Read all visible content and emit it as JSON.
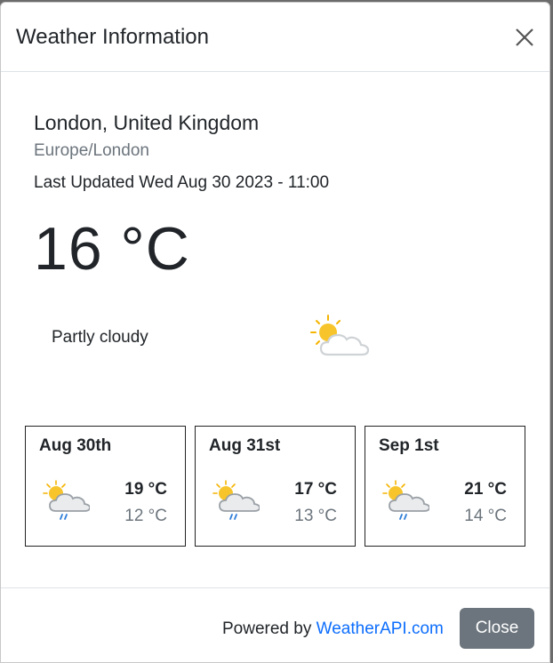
{
  "dialog": {
    "title": "Weather Information",
    "close_icon": "close-icon"
  },
  "location": {
    "name": "London, United Kingdom",
    "timezone": "Europe/London",
    "last_updated": "Last Updated Wed Aug 30 2023 - 11:00"
  },
  "current": {
    "temperature": "16 °C",
    "condition": "Partly cloudy",
    "icon": "partly-cloudy-icon"
  },
  "forecast": [
    {
      "date": "Aug 30th",
      "max": "19 °C",
      "min": "12 °C",
      "icon": "patchy-rain-icon"
    },
    {
      "date": "Aug 31st",
      "max": "17 °C",
      "min": "13 °C",
      "icon": "patchy-rain-icon"
    },
    {
      "date": "Sep 1st",
      "max": "21 °C",
      "min": "14 °C",
      "icon": "patchy-rain-icon"
    }
  ],
  "footer": {
    "powered_prefix": "Powered by",
    "powered_link": "WeatherAPI.com",
    "close_label": "Close",
    "link_color": "#0d6efd",
    "button_color": "#6c757d"
  }
}
